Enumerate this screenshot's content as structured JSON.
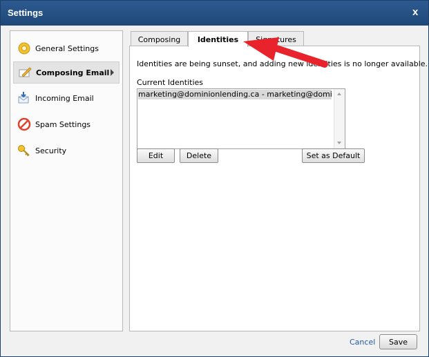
{
  "window": {
    "title": "Settings",
    "close_label": "x"
  },
  "sidebar": {
    "items": [
      {
        "label": "General Settings",
        "icon": "gear-icon",
        "active": false
      },
      {
        "label": "Composing Email",
        "icon": "compose-icon",
        "active": true
      },
      {
        "label": "Incoming Email",
        "icon": "incoming-mail-icon",
        "active": false
      },
      {
        "label": "Spam Settings",
        "icon": "no-entry-icon",
        "active": false
      },
      {
        "label": "Security",
        "icon": "key-icon",
        "active": false
      }
    ]
  },
  "tabs": [
    {
      "label": "Composing",
      "active": false
    },
    {
      "label": "Identities",
      "active": true
    },
    {
      "label": "Signatures",
      "active": false
    }
  ],
  "identities": {
    "notice": "Identities are being sunset, and adding new identities is no longer available.",
    "current_label": "Current Identities",
    "list": [
      "marketing@dominionlending.ca - marketing@dominionlending.ca"
    ]
  },
  "buttons": {
    "edit": "Edit",
    "delete": "Delete",
    "set_default": "Set as Default"
  },
  "footer": {
    "cancel": "Cancel",
    "save": "Save"
  },
  "colors": {
    "titlebar": "#2a5588",
    "accent": "#e8232b",
    "link": "#1e5aa8"
  }
}
